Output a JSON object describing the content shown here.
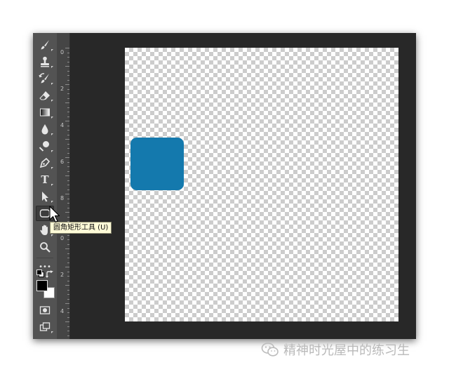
{
  "tooltip": {
    "text": "圆角矩形工具 (U)"
  },
  "ruler": {
    "labels": [
      "0",
      "2",
      "4",
      "6",
      "8",
      "0",
      "2",
      "4"
    ]
  },
  "tools": [
    {
      "name": "brush-tool-icon"
    },
    {
      "name": "clone-stamp-tool-icon"
    },
    {
      "name": "history-brush-tool-icon"
    },
    {
      "name": "eraser-tool-icon"
    },
    {
      "name": "gradient-tool-icon"
    },
    {
      "name": "blur-tool-icon"
    },
    {
      "name": "dodge-tool-icon"
    },
    {
      "name": "pen-tool-icon"
    },
    {
      "name": "type-tool-icon",
      "label": "T"
    },
    {
      "name": "path-selection-tool-icon"
    },
    {
      "name": "rounded-rectangle-tool-icon",
      "active": true
    },
    {
      "name": "hand-tool-icon"
    },
    {
      "name": "zoom-tool-icon"
    },
    {
      "name": "more-tools-icon",
      "label": "•••"
    },
    {
      "name": "default-colors-icon"
    },
    {
      "name": "swap-colors-icon"
    },
    {
      "name": "foreground-background-color"
    },
    {
      "name": "quick-mask-icon"
    },
    {
      "name": "screen-mode-icon"
    }
  ],
  "colors": {
    "foreground": "#000000",
    "background": "#ffffff",
    "shape_fill": "#1479ad",
    "toolbar_bg": "#535353",
    "workspace_bg": "#282828"
  },
  "watermark": {
    "text": "精神时光屋中的练习生",
    "icon": "wechat-icon"
  }
}
